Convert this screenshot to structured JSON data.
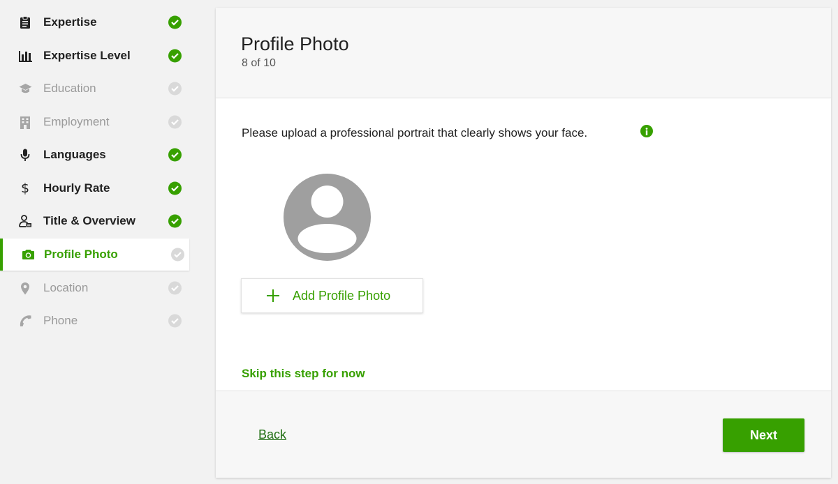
{
  "sidebar": {
    "items": [
      {
        "label": "Expertise",
        "icon": "clipboard-icon",
        "status": "done"
      },
      {
        "label": "Expertise Level",
        "icon": "bar-chart-icon",
        "status": "done"
      },
      {
        "label": "Education",
        "icon": "graduation-cap-icon",
        "status": "pending"
      },
      {
        "label": "Employment",
        "icon": "building-icon",
        "status": "pending"
      },
      {
        "label": "Languages",
        "icon": "microphone-icon",
        "status": "done"
      },
      {
        "label": "Hourly Rate",
        "icon": "dollar-icon",
        "status": "done"
      },
      {
        "label": "Title & Overview",
        "icon": "user-card-icon",
        "status": "done"
      },
      {
        "label": "Profile Photo",
        "icon": "camera-icon",
        "status": "active"
      },
      {
        "label": "Location",
        "icon": "map-pin-icon",
        "status": "pending"
      },
      {
        "label": "Phone",
        "icon": "phone-icon",
        "status": "pending"
      }
    ]
  },
  "main": {
    "title": "Profile Photo",
    "step": "8 of 10",
    "instructions": "Please upload a professional portrait that clearly shows your face.",
    "add_photo_label": "Add Profile Photo",
    "skip_label": "Skip this step for now",
    "back_label": "Back",
    "next_label": "Next"
  },
  "colors": {
    "accent": "#37a000",
    "pending": "#9a9a9a",
    "link": "#1f6e12"
  }
}
